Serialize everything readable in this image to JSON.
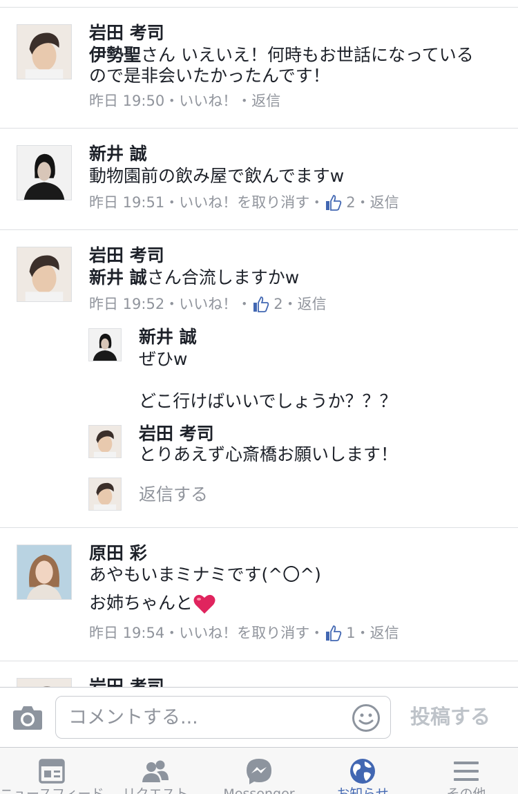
{
  "comments": [
    {
      "author": "岩田 考司",
      "mention": "伊勢聖",
      "lines": [
        "さん いえいえ！何時もお世話になっている",
        "ので是非会いたかったんです！"
      ],
      "meta": {
        "time": "昨日 19:50",
        "actions": "・いいね！・返信"
      }
    },
    {
      "author": "新井 誠",
      "lines": [
        "動物園前の飲み屋で飲んでますw"
      ],
      "meta": {
        "time": "昨日 19:51",
        "actions": "・いいね！を取り消す・",
        "like_count": "2",
        "reply": "・返信"
      }
    },
    {
      "author": "岩田 考司",
      "mention": "新井 誠",
      "lines": [
        "さん合流しますかw"
      ],
      "meta": {
        "time": "昨日 19:52",
        "actions": "・いいね！・",
        "like_count": "2",
        "reply": "・返信"
      },
      "replies": [
        {
          "author": "新井 誠",
          "lines": [
            "ぜひw",
            "",
            "どこ行けばいいでしょうか？？？"
          ]
        },
        {
          "author": "岩田 考司",
          "lines": [
            "とりあえず心斎橋お願いします！"
          ]
        }
      ],
      "reply_placeholder": "返信する"
    },
    {
      "author": "原田 彩",
      "lines": [
        "あやもいまミナミです(^〇^)",
        "お姉ちゃんと"
      ],
      "meta": {
        "time": "昨日 19:54",
        "actions": "・いいね！を取り消す・",
        "like_count": "1",
        "reply": "・返信"
      }
    },
    {
      "author": "岩田 考司"
    }
  ],
  "composer": {
    "camera_icon": "camera-icon",
    "placeholder": "コメントする...",
    "emoji_icon": "smiley-icon",
    "post_label": "投稿する"
  },
  "tabbar": {
    "tabs": [
      {
        "label": "ニュースフィード",
        "icon": "news-feed-icon",
        "active": false
      },
      {
        "label": "リクエスト",
        "icon": "friends-icon",
        "active": false
      },
      {
        "label": "Messenger",
        "icon": "messenger-icon",
        "active": false
      },
      {
        "label": "お知らせ",
        "icon": "globe-icon",
        "active": true
      },
      {
        "label": "その他",
        "icon": "menu-icon",
        "active": false
      }
    ]
  },
  "colors": {
    "link_blue": "#4267b2",
    "meta_gray": "#90949c",
    "divider": "#dddfe2",
    "heart_red": "#e0245e"
  }
}
